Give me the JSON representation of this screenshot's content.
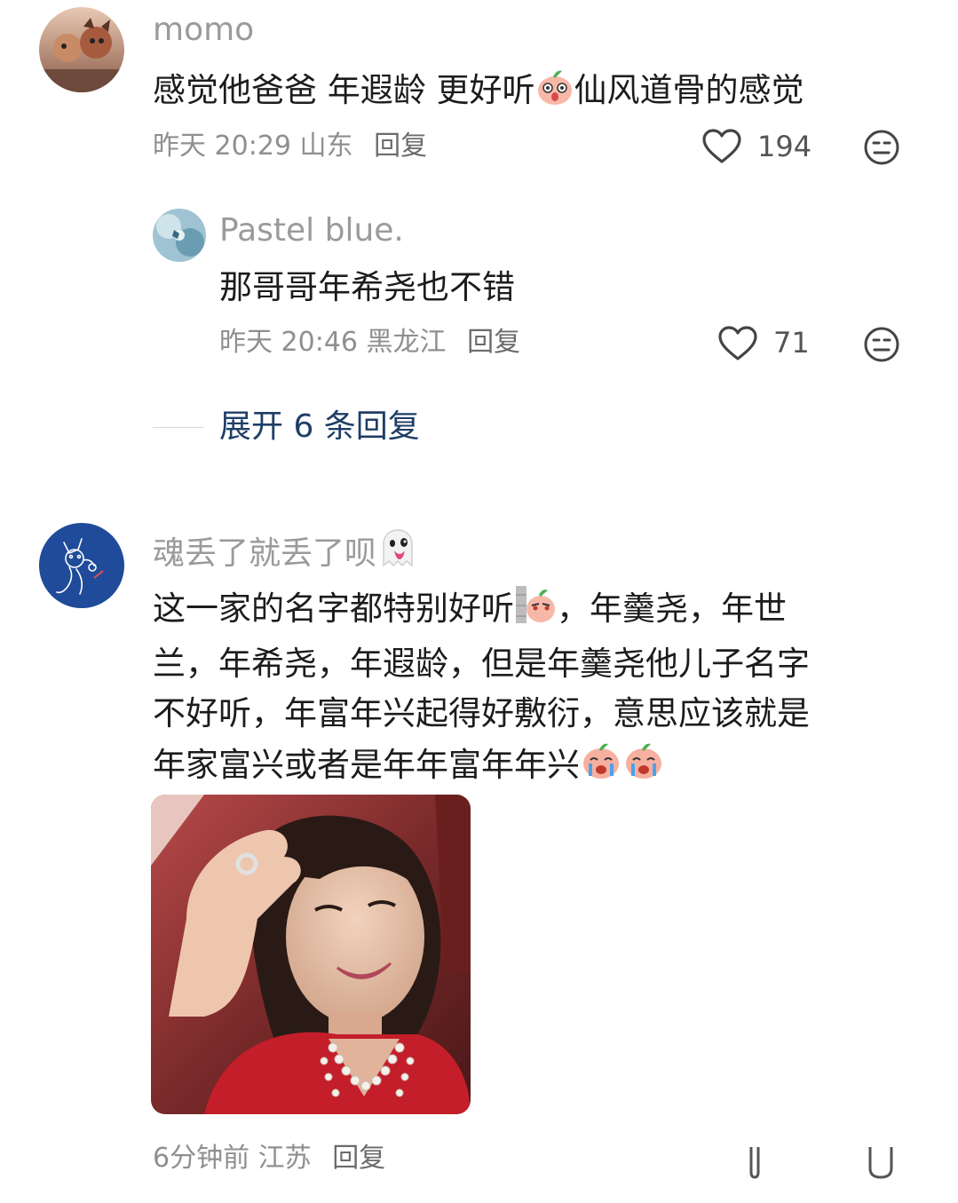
{
  "comments": [
    {
      "username": "momo",
      "text_a": "感觉他爸爸 年遐龄 更好听",
      "text_b": "仙风道骨的感觉",
      "time": "昨天 20:29",
      "location": "山东",
      "reply_label": "回复",
      "likes": "194",
      "replies": [
        {
          "username": "Pastel blue.",
          "text": "那哥哥年希尧也不错",
          "time": "昨天 20:46",
          "location": "黑龙江",
          "reply_label": "回复",
          "likes": "71"
        }
      ],
      "expand_label": "展开 6 条回复"
    },
    {
      "username": "魂丢了就丢了呗",
      "line1a": "这一家的名字都特别好听",
      "line1b": "，年羹尧，年世",
      "line2": "兰，年希尧，年遐龄，但是年羹尧他儿子名字",
      "line3": "不好听，年富年兴起得好敷衍，意思应该就是",
      "line4": "年家富兴或者是年年富年年兴",
      "time": "6分钟前",
      "location": "江苏",
      "reply_label": "回复"
    }
  ],
  "colors": {
    "link_blue": "#1f3e66",
    "meta_gray": "#8f8f8f",
    "name_gray": "#9a9a9a"
  },
  "icons": [
    "heart-outline-icon",
    "meh-face-icon",
    "surprised-peach-emoji",
    "ghost-emoji",
    "peeking-peach-emoji",
    "crying-peach-emoji"
  ]
}
